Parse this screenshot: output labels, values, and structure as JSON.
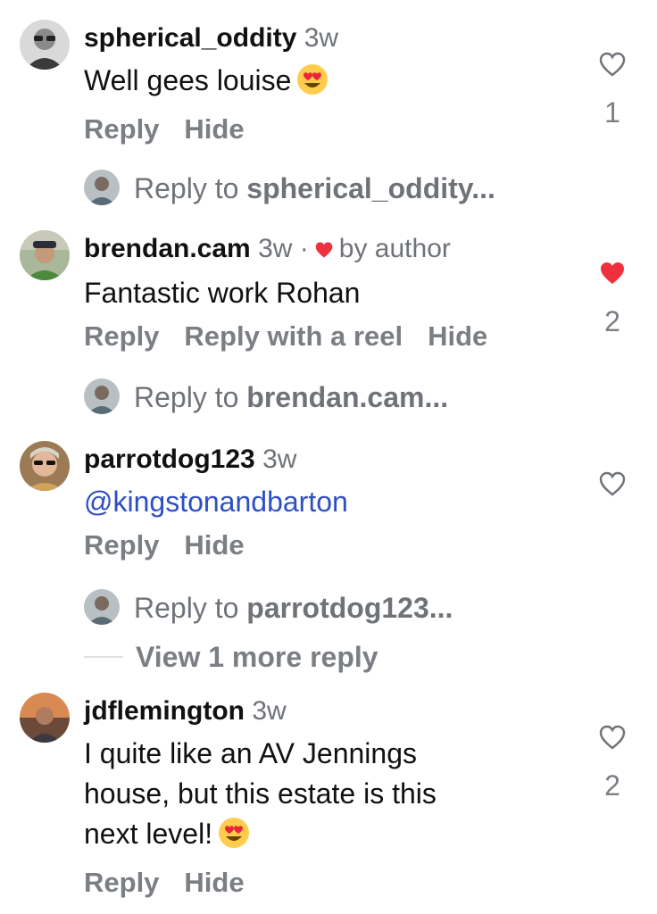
{
  "comments": [
    {
      "username": "spherical_oddity",
      "time": "3w",
      "text": "Well gees louise",
      "actions": [
        "Reply",
        "Hide"
      ],
      "liked": false,
      "like_count": "1",
      "reply_to_prefix": "Reply to",
      "reply_to_target": "spherical_oddity..."
    },
    {
      "username": "brendan.cam",
      "time": "3w",
      "dot": "·",
      "by_author": "by author",
      "text": "Fantastic work Rohan",
      "actions": [
        "Reply",
        "Reply with a reel",
        "Hide"
      ],
      "liked": true,
      "like_count": "2",
      "reply_to_prefix": "Reply to",
      "reply_to_target": "brendan.cam..."
    },
    {
      "username": "parrotdog123",
      "time": "3w",
      "text": "@kingstonandbarton",
      "actions": [
        "Reply",
        "Hide"
      ],
      "liked": false,
      "like_count": "",
      "reply_to_prefix": "Reply to",
      "reply_to_target": "parrotdog123...",
      "view_more": "View 1 more reply"
    },
    {
      "username": "jdflemington",
      "time": "3w",
      "text_lines": [
        "I quite like an AV Jennings",
        "house, but this estate is this",
        "next level!"
      ],
      "actions": [
        "Reply",
        "Hide"
      ],
      "liked": false,
      "like_count": "2"
    }
  ],
  "colors": {
    "liked_heart": "#f0303e",
    "mention": "#2e4fc4",
    "secondary_text": "#7b7f84"
  },
  "icons": {
    "emoji": "smiling-face-with-heart-eyes",
    "like": "heart-outline-icon",
    "liked": "heart-filled-icon"
  }
}
